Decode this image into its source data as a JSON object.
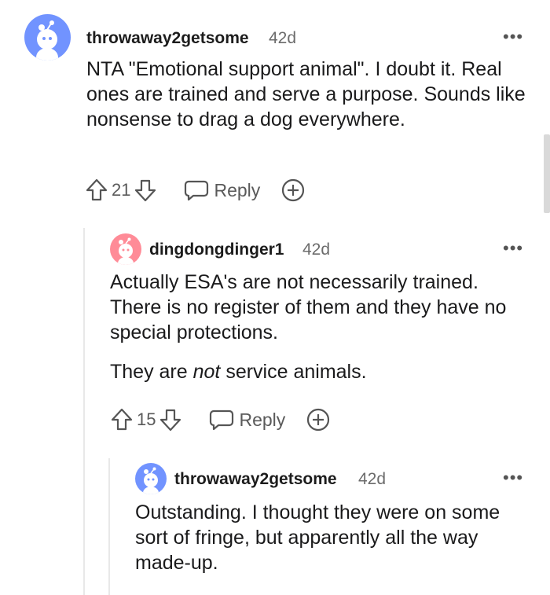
{
  "comments": [
    {
      "username": "throwaway2getsome",
      "age": "42d",
      "paragraphs": [
        "NTA \"Emotional support animal\". I doubt it. Real ones are trained and serve a purpose. Sounds like nonsense to drag a dog everywhere."
      ],
      "votes": "21",
      "reply_label": "Reply",
      "avatar_color": "#7193ff"
    },
    {
      "username": "dingdongdinger1",
      "age": "42d",
      "paragraphs": [
        "Actually ESA's are not necessarily trained. There is no register of them and they have no special protections."
      ],
      "second_para": {
        "before": "They are ",
        "emphasis": "not",
        "after": " service animals."
      },
      "votes": "15",
      "reply_label": "Reply",
      "avatar_color": "#ff8b97"
    },
    {
      "username": "throwaway2getsome",
      "age": "42d",
      "paragraphs": [
        "Outstanding. I thought they were on some sort of fringe, but apparently all the way made-up."
      ],
      "avatar_color": "#7193ff"
    }
  ],
  "menu_glyph": "•••",
  "icons": [
    "upvote-icon",
    "downvote-icon",
    "reply-bubble-icon",
    "award-icon",
    "overflow-menu-icon",
    "snoo-avatar-icon"
  ]
}
